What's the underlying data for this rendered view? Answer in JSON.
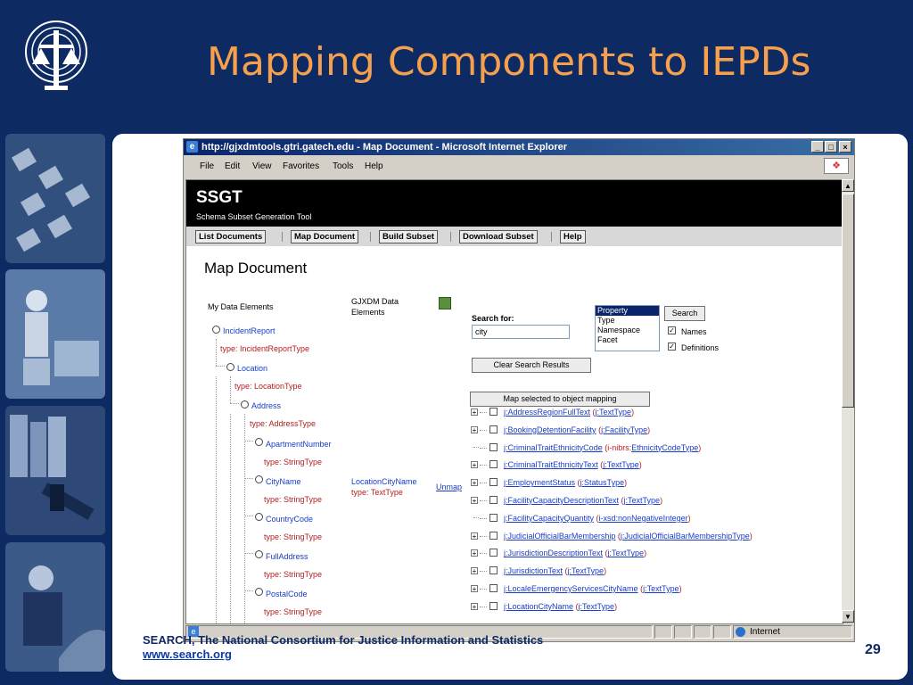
{
  "slide": {
    "title": "Mapping Components to IEPDs",
    "footer_line1": "SEARCH, The National Consortium for Justice Information and Statistics",
    "footer_link": "www.search.org",
    "page_number": "29"
  },
  "browser": {
    "window_title": "http://gjxdmtools.gtri.gatech.edu - Map Document - Microsoft Internet Explorer",
    "menu": [
      "File",
      "Edit",
      "View",
      "Favorites",
      "Tools",
      "Help"
    ],
    "status_zone": "Internet"
  },
  "app": {
    "name": "SSGT",
    "subtitle": "Schema Subset Generation Tool",
    "nav": [
      "List Documents",
      "Map Document",
      "Build Subset",
      "Download Subset",
      "Help"
    ],
    "page_title": "Map Document",
    "my_data_label": "My Data Elements",
    "gjxdm_label_1": "GJXDM Data",
    "gjxdm_label_2": "Elements",
    "tree": [
      {
        "name": "IncidentReport",
        "type": "type: IncidentReportType"
      },
      {
        "name": "Location",
        "type": "type: LocationType"
      },
      {
        "name": "Address",
        "type": "type: AddressType"
      },
      {
        "name": "ApartmentNumber",
        "type": "type: StringType"
      },
      {
        "name": "CityName",
        "type": "type: StringType"
      },
      {
        "name": "CountryCode",
        "type": "type: StringType"
      },
      {
        "name": "FullAddress",
        "type": "type: StringType"
      },
      {
        "name": "PostalCode",
        "type": "type: StringType"
      }
    ],
    "mapping": {
      "name": "LocationCityName",
      "type": "type: TextType",
      "unmap": "Unmap"
    },
    "search": {
      "label": "Search for:",
      "value": "city",
      "button": "Search",
      "options": [
        "Property",
        "Type",
        "Namespace",
        "Facet"
      ],
      "names_label": "Names",
      "definitions_label": "Definitions",
      "clear_button": "Clear Search Results",
      "map_button": "Map selected to object mapping"
    },
    "results": [
      {
        "expand": true,
        "prop": "j:AddressRegionFullText",
        "pre": " (",
        "type": "j:TextType",
        "post": ")"
      },
      {
        "expand": true,
        "prop": "j:BookingDetentionFacility",
        "pre": " (",
        "type": "j:FacilityType",
        "post": ")"
      },
      {
        "expand": false,
        "prop": "j:CriminalTraitEthnicityCode",
        "pre": " (i-nibrs:",
        "type": "EthnicityCodeType",
        "post": ")"
      },
      {
        "expand": true,
        "prop": "j:CriminalTraitEthnicityText",
        "pre": " (",
        "type": "j:TextType",
        "post": ")"
      },
      {
        "expand": true,
        "prop": "j:EmploymentStatus",
        "pre": " (",
        "type": "j:StatusType",
        "post": ")"
      },
      {
        "expand": true,
        "prop": "j:FacilityCapacityDescriptionText",
        "pre": " (",
        "type": "j:TextType",
        "post": ")"
      },
      {
        "expand": false,
        "prop": "j:FacilityCapacityQuantity",
        "pre": " (",
        "type": "i-xsd:nonNegativeInteger",
        "post": ")"
      },
      {
        "expand": true,
        "prop": "j:JudicialOfficialBarMembership",
        "pre": " (",
        "type": "j:JudicialOfficialBarMembershipType",
        "post": ")"
      },
      {
        "expand": true,
        "prop": "j:JurisdictionDescriptionText",
        "pre": " (",
        "type": "j:TextType",
        "post": ")"
      },
      {
        "expand": true,
        "prop": "j:JurisdictionText",
        "pre": " (",
        "type": "j:TextType",
        "post": ")"
      },
      {
        "expand": true,
        "prop": "j:LocaleEmergencyServicesCityName",
        "pre": " (",
        "type": "j:TextType",
        "post": ")"
      },
      {
        "expand": true,
        "prop": "j:LocationCityName",
        "pre": " (",
        "type": "j:TextType",
        "post": ")"
      }
    ]
  },
  "colors": {
    "slide_bg": "#0d2a63",
    "title": "#f6a04d",
    "link": "#1a3cc8",
    "type_text": "#b52020"
  }
}
